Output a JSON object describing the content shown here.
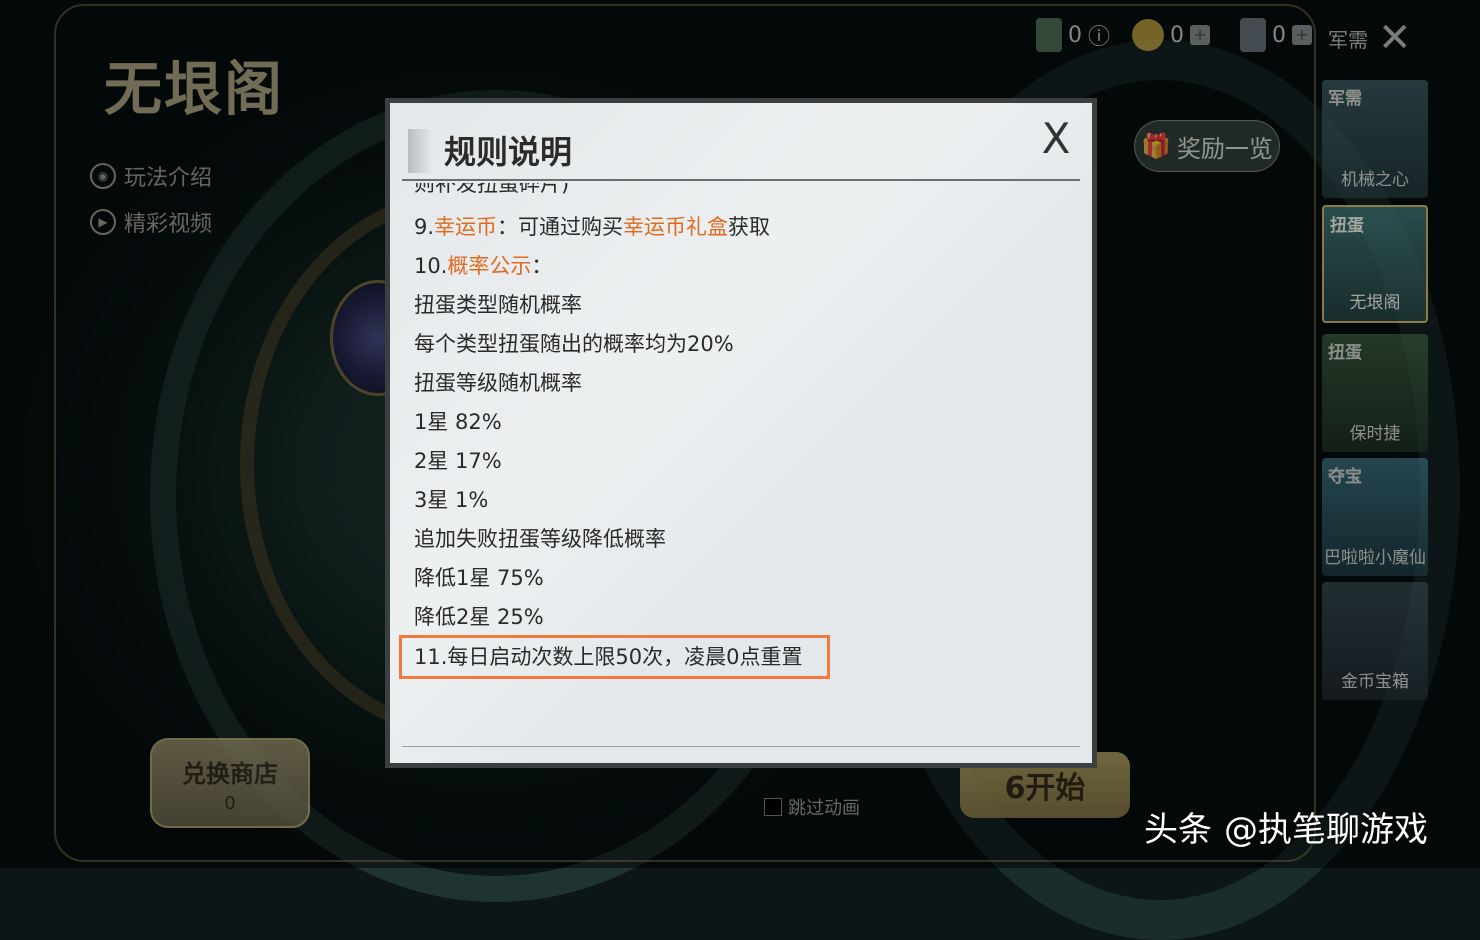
{
  "background": {
    "logo_title": "无垠阁",
    "side_links": [
      {
        "label": "玩法介绍",
        "icon": "gamepad-icon"
      },
      {
        "label": "精彩视频",
        "icon": "play-icon"
      }
    ],
    "reward_button": "奖励一览",
    "shop_button": {
      "label": "兑换商店",
      "count": "0"
    },
    "start_button": "6开始",
    "skip_animation": "跳过动画"
  },
  "top_bar": {
    "currencies": [
      {
        "icon": "green-card-icon",
        "value": "0"
      },
      {
        "icon": "gold-coin-icon",
        "value": "0"
      },
      {
        "icon": "gray-card-icon",
        "value": "0"
      }
    ],
    "close_label": "军需",
    "close_icon": "close-icon"
  },
  "right_tabs": [
    {
      "tag": "军需",
      "name": "机械之心"
    },
    {
      "tag": "扭蛋",
      "name": "无垠阁"
    },
    {
      "tag": "扭蛋",
      "name": "保时捷"
    },
    {
      "tag": "夺宝",
      "name": "巴啦啦小魔仙"
    },
    {
      "tag": "",
      "name": "金币宝箱"
    }
  ],
  "dialog": {
    "title": "规则说明",
    "close_glyph": "X",
    "lines": [
      {
        "text": "则补发扭蛋碎片)"
      },
      {
        "prefix": "9.",
        "hl1": "幸运币",
        "mid": "：可通过购买",
        "hl2": "幸运币礼盒",
        "suffix": "获取"
      },
      {
        "prefix": "10.",
        "hl1": "概率公示",
        "suffix": "："
      },
      {
        "text": "扭蛋类型随机概率"
      },
      {
        "text": "每个类型扭蛋随出的概率均为20%"
      },
      {
        "text": "扭蛋等级随机概率"
      },
      {
        "text": "1星 82%"
      },
      {
        "text": "2星 17%"
      },
      {
        "text": "3星 1%"
      },
      {
        "text": "追加失败扭蛋等级降低概率"
      },
      {
        "text": "降低1星 75%"
      },
      {
        "text": "降低2星 25%"
      },
      {
        "text": "11.每日启动次数上限50次，凌晨0点重置"
      }
    ],
    "highlight_color": "#e06a1e",
    "annotation_color": "#f07a3c"
  },
  "watermark": {
    "brand": "头条",
    "account": "@执笔聊游戏"
  }
}
